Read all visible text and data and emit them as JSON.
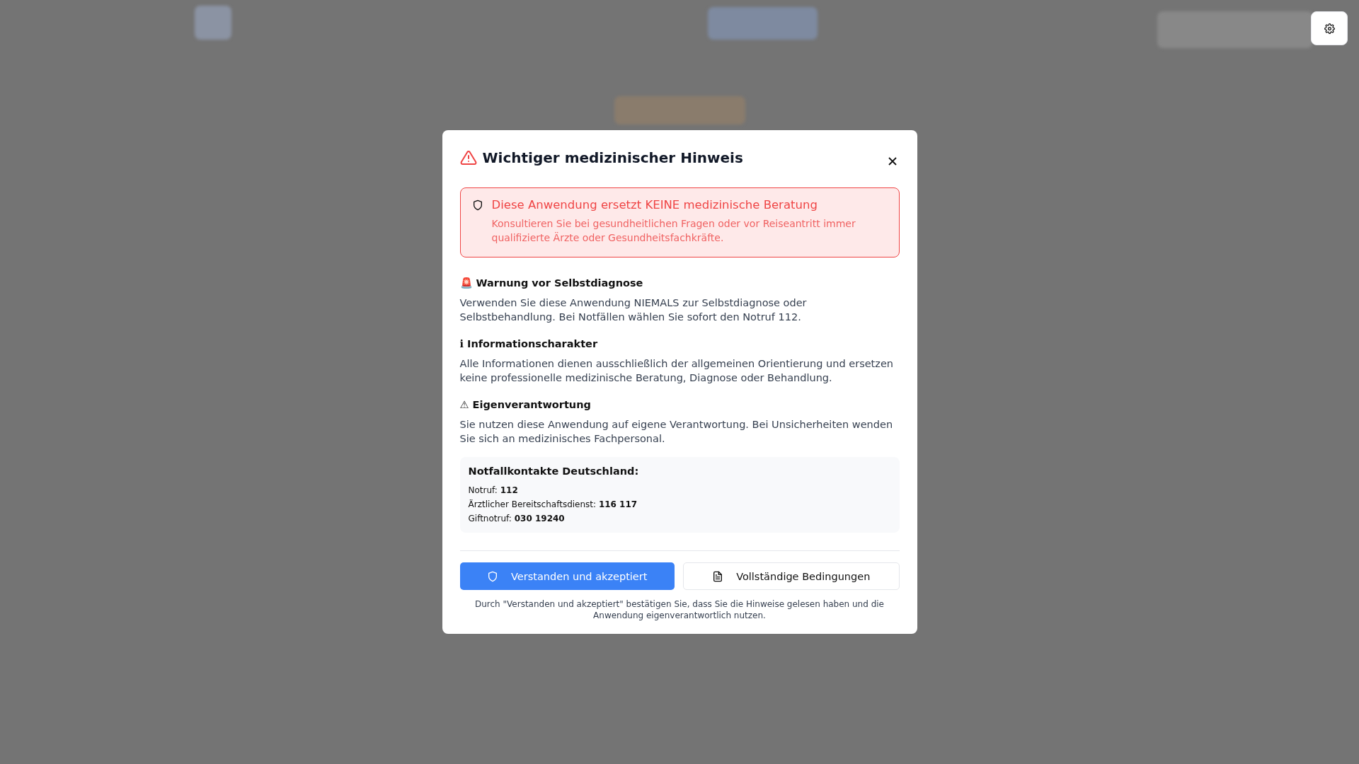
{
  "dialog": {
    "title": "Wichtiger medizinischer Hinweis",
    "alert": {
      "heading": "Diese Anwendung ersetzt KEINE medizinische Beratung",
      "text": "Konsultieren Sie bei gesundheitlichen Fragen oder vor Reiseantritt immer qualifizierte Ärzte oder Gesundheitsfachkräfte."
    },
    "sections": [
      {
        "heading": "🚨 Warnung vor Selbstdiagnose",
        "text": "Verwenden Sie diese Anwendung NIEMALS zur Selbstdiagnose oder Selbstbehandlung. Bei Notfällen wählen Sie sofort den Notruf 112."
      },
      {
        "heading": "ℹ Informationscharakter",
        "text": "Alle Informationen dienen ausschließlich der allgemeinen Orientierung und ersetzen keine professionelle medizinische Beratung, Diagnose oder Behandlung."
      },
      {
        "heading": "⚠ Eigenverantwortung",
        "text": "Sie nutzen diese Anwendung auf eigene Verantwortung. Bei Unsicherheiten wenden Sie sich an medizinisches Fachpersonal."
      }
    ],
    "contacts": {
      "heading": "Notfallkontakte Deutschland:",
      "lines": [
        "Notruf: **112**",
        "Ärztlicher Bereitschaftsdienst: **116 117**",
        "Giftnotruf: **030 19240**"
      ]
    },
    "buttons": [
      {
        "label": "Verstanden und akzeptiert",
        "kind": "primary"
      },
      {
        "label": "Vollständige Bedingungen",
        "kind": "secondary"
      }
    ],
    "footnote": "Durch \"Verstanden und akzeptiert\" bestätigen Sie, dass Sie die Hinweise gelesen haben und die Anwendung eigenverantwortlich nutzen."
  }
}
